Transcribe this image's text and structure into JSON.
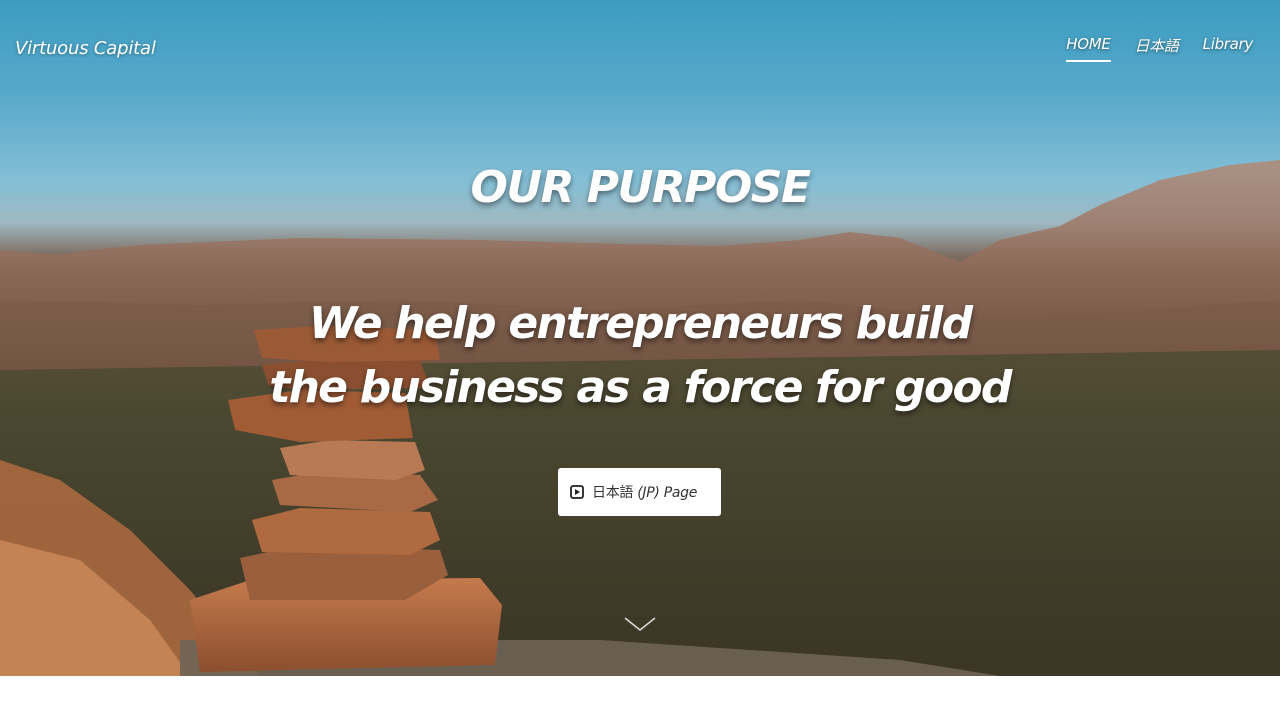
{
  "header": {
    "brand": "Virtuous Capital",
    "nav": [
      {
        "label": "HOME",
        "active": true
      },
      {
        "label": "日本語",
        "active": false
      },
      {
        "label": "Library",
        "active": false
      }
    ]
  },
  "hero": {
    "headline": "OUR PURPOSE",
    "tagline_line1": "We help entrepreneurs build",
    "tagline_line2": "the business as a force for good",
    "cta": {
      "label_jp": "日本語",
      "label_rest": "(JP) Page",
      "icon": "play-square-icon"
    },
    "scroll_icon": "chevron-down-icon"
  },
  "colors": {
    "sky": "#3c9cc0",
    "text": "#ffffff",
    "button_bg": "#ffffff",
    "button_text": "#333333"
  }
}
